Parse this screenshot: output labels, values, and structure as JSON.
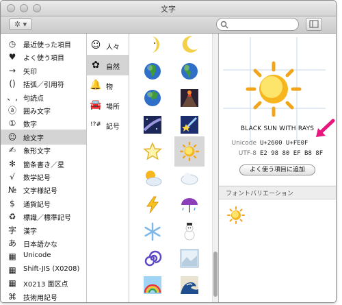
{
  "window": {
    "title": "文字"
  },
  "toolbar": {
    "action_label": "✲ ▾",
    "search_placeholder": ""
  },
  "categories": [
    {
      "icon": "clock-icon",
      "glyph": "◷",
      "label": "最近使った項目"
    },
    {
      "icon": "heart-icon",
      "glyph": "♥",
      "label": "よく使う項目"
    },
    {
      "icon": "arrow-icon",
      "glyph": "→",
      "label": "矢印"
    },
    {
      "icon": "parentheses-icon",
      "glyph": "()",
      "label": "括弧／引用符"
    },
    {
      "icon": "punctuation-icon",
      "glyph": "、,",
      "label": "句読点"
    },
    {
      "icon": "enclosed-a-icon",
      "glyph": "ⓐ",
      "label": "囲み文字"
    },
    {
      "icon": "enclosed-one-icon",
      "glyph": "①",
      "label": "数字"
    },
    {
      "icon": "smiley-icon",
      "glyph": "☺",
      "label": "絵文字"
    },
    {
      "icon": "pictograph-icon",
      "glyph": "✍",
      "label": "象形文字"
    },
    {
      "icon": "asterisk-icon",
      "glyph": "✻",
      "label": "箇条書き／星"
    },
    {
      "icon": "math-icon",
      "glyph": "√",
      "label": "数学記号"
    },
    {
      "icon": "numero-icon",
      "glyph": "№",
      "label": "文字様記号"
    },
    {
      "icon": "dollar-icon",
      "glyph": "$",
      "label": "通貨記号"
    },
    {
      "icon": "recycle-icon",
      "glyph": "♻",
      "label": "標識／標準記号"
    },
    {
      "icon": "kanji-icon",
      "glyph": "字",
      "label": "漢字"
    },
    {
      "icon": "hiragana-icon",
      "glyph": "あ",
      "label": "日本語かな"
    },
    {
      "icon": "grid-icon",
      "glyph": "▦",
      "label": "Unicode"
    },
    {
      "icon": "grid-icon",
      "glyph": "▦",
      "label": "Shift-JIS (X0208)"
    },
    {
      "icon": "grid-icon",
      "glyph": "▦",
      "label": "X0213 面区点"
    },
    {
      "icon": "command-icon",
      "glyph": "⌘",
      "label": "技術用記号"
    }
  ],
  "selected_category": 7,
  "subcategories": [
    {
      "icon": "smiley-icon",
      "glyph": "☺",
      "label": "人々"
    },
    {
      "icon": "flower-icon",
      "glyph": "✿",
      "label": "自然"
    },
    {
      "icon": "bell-icon",
      "glyph": "🔔",
      "label": "物"
    },
    {
      "icon": "car-icon",
      "glyph": "🚘",
      "label": "場所"
    },
    {
      "icon": "symbols-icon",
      "glyph": "!?#",
      "label": "記号"
    }
  ],
  "selected_subcategory": 1,
  "emoji_grid": [
    "last-quarter-moon-face-icon",
    "crescent-moon-icon",
    "earth-africa-icon",
    "earth-americas-icon",
    "earth-asia-icon",
    "volcano-icon",
    "milky-way-icon",
    "shooting-star-icon",
    "white-star-icon",
    "black-sun-with-rays-icon",
    "sun-behind-cloud-icon",
    "cloud-icon",
    "lightning-icon",
    "umbrella-with-rain-icon",
    "snowflake-icon",
    "snowman-icon",
    "cyclone-icon",
    "foggy-icon",
    "rainbow-icon",
    "water-wave-icon"
  ],
  "selected_emoji": 9,
  "detail": {
    "char_name": "BLACK SUN WITH RAYS",
    "unicode_label": "Unicode",
    "unicode_value": "U+2600 U+FE0F",
    "utf8_label": "UTF-8",
    "utf8_value": "E2 98 80 EF B8 8F",
    "add_favorite": "よく使う項目に追加",
    "variation_header": "フォントバリエーション"
  },
  "annotation_color": "#e8177d"
}
